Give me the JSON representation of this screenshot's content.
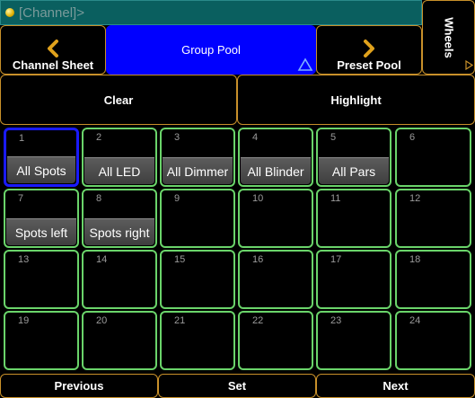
{
  "command_line": {
    "text": "[Channel]>"
  },
  "top_nav": {
    "channel_sheet": "Channel Sheet",
    "group_pool": "Group Pool",
    "preset_pool": "Preset Pool",
    "wheels": "Wheels"
  },
  "actions": {
    "clear": "Clear",
    "highlight": "Highlight"
  },
  "colors": {
    "accent_border": "#c8902a",
    "tile_border": "#6ad46a",
    "selected_border": "#1a1aff",
    "active_tab": "#0000ff"
  },
  "groups": [
    {
      "num": "1",
      "label": "All Spots",
      "selected": true
    },
    {
      "num": "2",
      "label": "All LED"
    },
    {
      "num": "3",
      "label": "All Dimmer"
    },
    {
      "num": "4",
      "label": "All Blinder"
    },
    {
      "num": "5",
      "label": "All Pars"
    },
    {
      "num": "6",
      "label": ""
    },
    {
      "num": "7",
      "label": "Spots left"
    },
    {
      "num": "8",
      "label": "Spots right"
    },
    {
      "num": "9",
      "label": ""
    },
    {
      "num": "10",
      "label": ""
    },
    {
      "num": "11",
      "label": ""
    },
    {
      "num": "12",
      "label": ""
    },
    {
      "num": "13",
      "label": ""
    },
    {
      "num": "14",
      "label": ""
    },
    {
      "num": "15",
      "label": ""
    },
    {
      "num": "16",
      "label": ""
    },
    {
      "num": "17",
      "label": ""
    },
    {
      "num": "18",
      "label": ""
    },
    {
      "num": "19",
      "label": ""
    },
    {
      "num": "20",
      "label": ""
    },
    {
      "num": "21",
      "label": ""
    },
    {
      "num": "22",
      "label": ""
    },
    {
      "num": "23",
      "label": ""
    },
    {
      "num": "24",
      "label": ""
    }
  ],
  "bottom_nav": {
    "previous": "Previous",
    "set": "Set",
    "next": "Next"
  }
}
